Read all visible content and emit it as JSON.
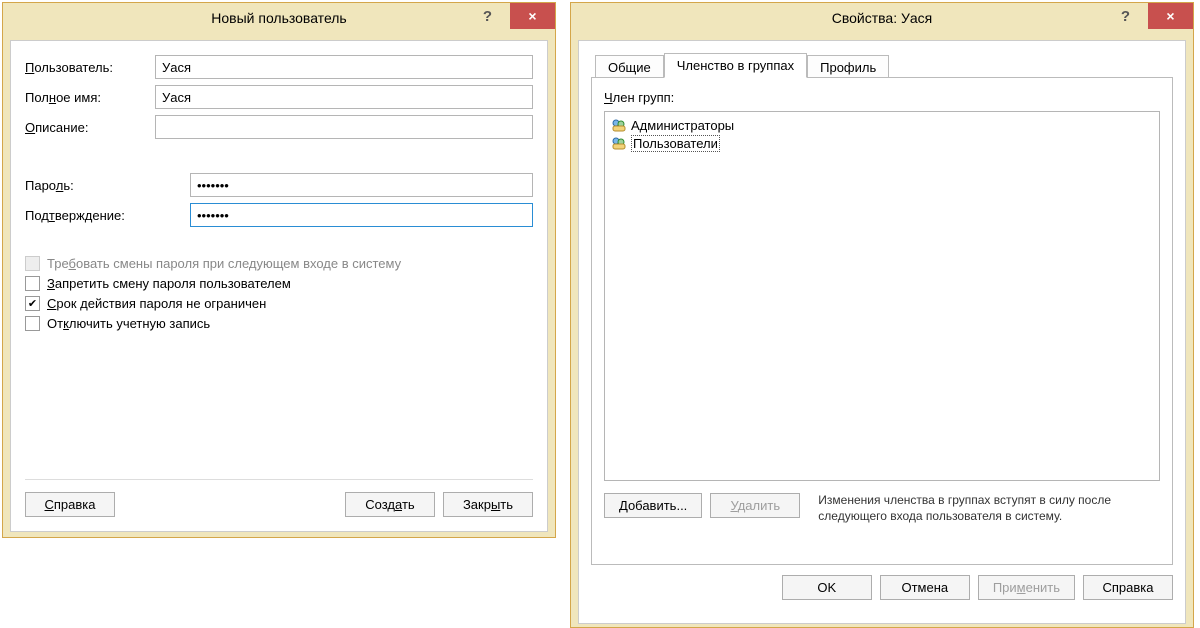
{
  "window_new_user": {
    "title": "Новый пользователь",
    "fields": {
      "user_label": {
        "pre": "",
        "u": "П",
        "post": "ользователь:"
      },
      "user_value": "Уася",
      "fullname_label": {
        "pre": "Пол",
        "u": "н",
        "post": "ое имя:"
      },
      "fullname_value": "Уася",
      "description_label": {
        "pre": "",
        "u": "О",
        "post": "писание:"
      },
      "description_value": "",
      "password_label": {
        "pre": "Паро",
        "u": "л",
        "post": "ь:"
      },
      "password_value": "•••••••",
      "confirm_label": {
        "pre": "Под",
        "u": "т",
        "post": "верждение:"
      },
      "confirm_value": "•••••••"
    },
    "checks": {
      "require_change": {
        "pre": "Тре",
        "u": "б",
        "post": "овать смены пароля при следующем входе в систему",
        "checked": false,
        "disabled": true
      },
      "deny_change": {
        "pre": "",
        "u": "З",
        "post": "апретить смену пароля пользователем",
        "checked": false,
        "disabled": false
      },
      "never_expire": {
        "pre": "",
        "u": "С",
        "post": "рок действия пароля не ограничен",
        "checked": true,
        "disabled": false
      },
      "disable_acct": {
        "pre": "От",
        "u": "к",
        "post": "лючить учетную запись",
        "checked": false,
        "disabled": false
      }
    },
    "buttons": {
      "help": {
        "pre": "",
        "u": "С",
        "post": "правка"
      },
      "create": {
        "pre": "Созд",
        "u": "а",
        "post": "ть"
      },
      "close": {
        "pre": "Закр",
        "u": "ы",
        "post": "ть"
      }
    }
  },
  "window_props": {
    "title": "Свойства: Уася",
    "tabs": {
      "general": "Общие",
      "membership": "Членство в группах",
      "profile": "Профиль"
    },
    "groups_label": {
      "pre": "",
      "u": "Ч",
      "post": "лен групп:"
    },
    "groups": [
      "Администраторы",
      "Пользователи"
    ],
    "selected_group_index": 1,
    "note": "Изменения членства в группах вступят в силу после следующего входа пользователя в систему.",
    "buttons": {
      "add": {
        "pre": "",
        "u": "Д",
        "post": "обавить..."
      },
      "remove": {
        "pre": "",
        "u": "У",
        "post": "далить"
      },
      "ok": "OK",
      "cancel": "Отмена",
      "apply": {
        "pre": "При",
        "u": "м",
        "post": "енить"
      },
      "help2": "Справка"
    }
  }
}
